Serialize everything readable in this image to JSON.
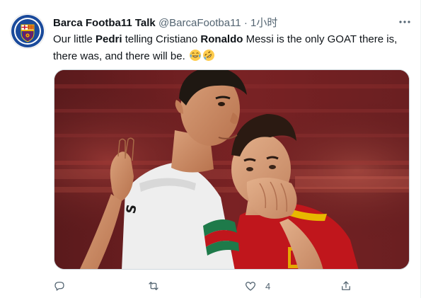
{
  "tweet": {
    "author_name": "Barca Footba11 Talk",
    "author_handle": "@BarcaFootba11",
    "separator": "·",
    "timestamp": "1小时",
    "text_parts": {
      "p1": "Our little ",
      "b1": "Pedri",
      "p2": " telling Cristiano ",
      "b2": "Ronaldo",
      "p3": " Messi is the only GOAT there is, there was, and there will be. "
    },
    "emojis": [
      "laughing-crying-emoji",
      "rolling-laughing-emoji"
    ],
    "image_icon": "photo-two-footballers-whispering"
  },
  "actions": {
    "reply_count": "",
    "retweet_count": "",
    "like_count": "4",
    "share_count": ""
  },
  "colors": {
    "text": "#0f1419",
    "muted": "#536471",
    "border": "#cfd9de"
  }
}
